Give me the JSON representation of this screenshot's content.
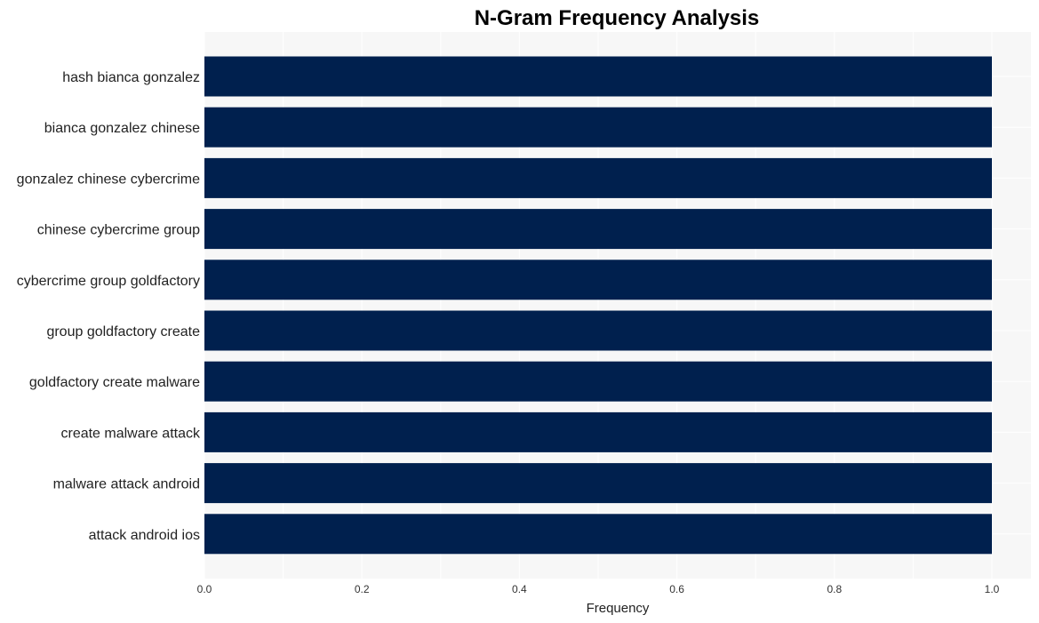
{
  "chart_data": {
    "type": "bar",
    "orientation": "horizontal",
    "title": "N-Gram Frequency Analysis",
    "xlabel": "Frequency",
    "ylabel": "",
    "categories": [
      "hash bianca gonzalez",
      "bianca gonzalez chinese",
      "gonzalez chinese cybercrime",
      "chinese cybercrime group",
      "cybercrime group goldfactory",
      "group goldfactory create",
      "goldfactory create malware",
      "create malware attack",
      "malware attack android",
      "attack android ios"
    ],
    "values": [
      1,
      1,
      1,
      1,
      1,
      1,
      1,
      1,
      1,
      1
    ],
    "xlim": [
      0,
      1.05
    ],
    "xticks": [
      "0.0",
      "0.2",
      "0.4",
      "0.6",
      "0.8",
      "1.0"
    ],
    "xtick_values": [
      0,
      0.2,
      0.4,
      0.6,
      0.8,
      1.0
    ],
    "grid": true,
    "bar_color": "#00204E",
    "plot_background": "#F7F7F7",
    "grid_color": "#FFFFFF"
  }
}
